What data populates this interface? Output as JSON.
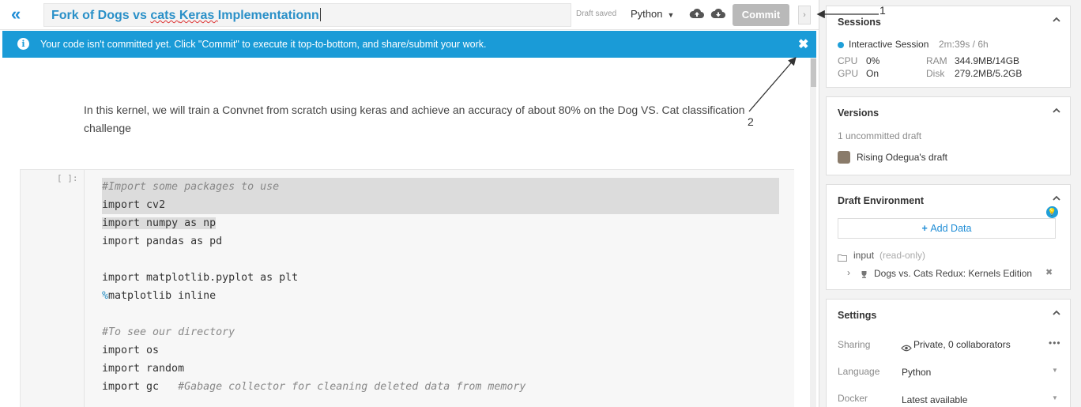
{
  "header": {
    "collapse_glyph": "«",
    "title": "Fork of Dogs vs cats Keras Implementationn",
    "draft_saved": "Draft saved",
    "language": "Python",
    "commit_label": "Commit",
    "expand_glyph": "›"
  },
  "banner": {
    "message": "Your code isn't committed yet. Click \"Commit\" to execute it top-to-bottom, and share/submit your work.",
    "close_glyph": "✖"
  },
  "notebook": {
    "markdown": "In this kernel, we will train a Convnet from scratch using keras and achieve an accuracy of about 80% on the Dog VS. Cat classification challenge",
    "cell_prompt": "[ ]:",
    "code": {
      "l1": "#Import some packages to use",
      "l2_kw": "import",
      "l2_rest": " cv2",
      "l3_kw": "import",
      "l3_rest": " numpy as np",
      "l4": "import pandas as pd",
      "l6": "import matplotlib.pyplot as plt",
      "l7_magic": "%",
      "l7_rest": "matplotlib inline",
      "l9": "#To see our directory",
      "l10": "import os",
      "l11": "import random",
      "l12_code": "import gc   ",
      "l12_comment": "#Gabage collector for cleaning deleted data from memory"
    }
  },
  "sidebar": {
    "sessions": {
      "title": "Sessions",
      "session_name": "Interactive Session",
      "session_time": "2m:39s / 6h",
      "cpu_label": "CPU",
      "cpu_value": "0%",
      "gpu_label": "GPU",
      "gpu_value": "On",
      "ram_label": "RAM",
      "ram_value": "344.9MB/14GB",
      "disk_label": "Disk",
      "disk_value": "279.2MB/5.2GB"
    },
    "versions": {
      "title": "Versions",
      "uncommitted": "1 uncommitted draft",
      "draft_name": "Rising Odegua's draft"
    },
    "environment": {
      "title": "Draft Environment",
      "add_data": "Add Data",
      "input_label": "input",
      "input_note": "(read-only)",
      "dataset": "Dogs vs. Cats Redux: Kernels Edition"
    },
    "settings": {
      "title": "Settings",
      "sharing_label": "Sharing",
      "sharing_value": "Private, 0 collaborators",
      "language_label": "Language",
      "language_value": "Python",
      "docker_label": "Docker",
      "docker_value": "Latest available"
    }
  },
  "annotations": {
    "label_1": "1",
    "label_2": "2"
  }
}
